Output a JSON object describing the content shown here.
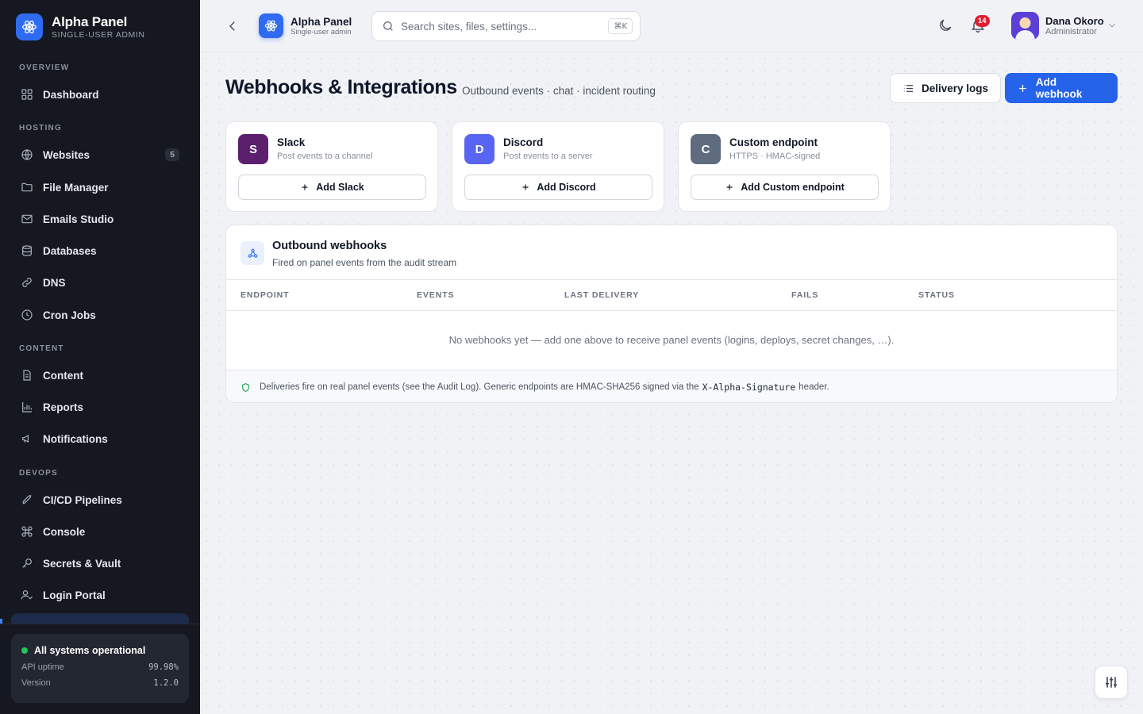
{
  "brand": {
    "title": "Alpha Panel",
    "subtitle": "SINGLE-USER ADMIN"
  },
  "sidebar": {
    "sections": [
      {
        "label": "OVERVIEW"
      },
      {
        "label": "HOSTING"
      },
      {
        "label": "CONTENT"
      },
      {
        "label": "DEVOPS"
      }
    ],
    "items": [
      {
        "label": "Dashboard",
        "icon": "grid-icon"
      },
      {
        "label": "Websites",
        "icon": "globe-icon",
        "badge": "5"
      },
      {
        "label": "File Manager",
        "icon": "folder-icon"
      },
      {
        "label": "Emails Studio",
        "icon": "mail-icon"
      },
      {
        "label": "Databases",
        "icon": "database-icon"
      },
      {
        "label": "DNS",
        "icon": "link-icon"
      },
      {
        "label": "Cron Jobs",
        "icon": "clock-icon"
      },
      {
        "label": "Content",
        "icon": "document-icon"
      },
      {
        "label": "Reports",
        "icon": "bar-chart-icon"
      },
      {
        "label": "Notifications",
        "icon": "megaphone-icon"
      },
      {
        "label": "CI/CD Pipelines",
        "icon": "rocket-icon"
      },
      {
        "label": "Console",
        "icon": "command-icon"
      },
      {
        "label": "Secrets & Vault",
        "icon": "key-icon"
      },
      {
        "label": "Login Portal",
        "icon": "user-check-icon"
      }
    ],
    "status": {
      "headline": "All systems operational",
      "rows": [
        {
          "label": "API uptime",
          "value": "99.98%"
        },
        {
          "label": "Version",
          "value": "1.2.0"
        }
      ]
    }
  },
  "header": {
    "app_name": "Alpha Panel",
    "app_sub": "Single-user admin",
    "search_placeholder": "Search sites, files, settings...",
    "search_shortcut": "⌘K",
    "notifications_count": "14",
    "user": {
      "name": "Dana Okoro",
      "role": "Administrator"
    }
  },
  "page": {
    "title": "Webhooks & Integrations",
    "subtitle": "Outbound events · chat · incident routing",
    "delivery_logs_label": "Delivery logs",
    "add_webhook_label": "Add webhook"
  },
  "providers": [
    {
      "initial": "S",
      "name": "Slack",
      "desc": "Post events to a channel",
      "button": "Add Slack",
      "color": "#5b1f6e"
    },
    {
      "initial": "D",
      "name": "Discord",
      "desc": "Post events to a server",
      "button": "Add Discord",
      "color": "#5865f2"
    },
    {
      "initial": "C",
      "name": "Custom endpoint",
      "desc": "HTTPS · HMAC-signed",
      "button": "Add Custom endpoint",
      "color": "#5f6b7e"
    }
  ],
  "webhooks_panel": {
    "title": "Outbound webhooks",
    "subtitle": "Fired on panel events from the audit stream",
    "columns": [
      "ENDPOINT",
      "EVENTS",
      "LAST DELIVERY",
      "FAILS",
      "STATUS"
    ],
    "empty_message": "No webhooks yet — add one above to receive panel events (logins, deploys, secret changes, …).",
    "footer": {
      "before": "Deliveries fire on real panel events (see the Audit Log). Generic endpoints are HMAC-SHA256 signed via the",
      "header_name": "X-Alpha-Signature",
      "after": "header."
    }
  },
  "colors": {
    "accent": "#2563eb",
    "sidebar_bg": "#151820",
    "status_ok": "#22c55e",
    "badge_red": "#e11d2e"
  }
}
